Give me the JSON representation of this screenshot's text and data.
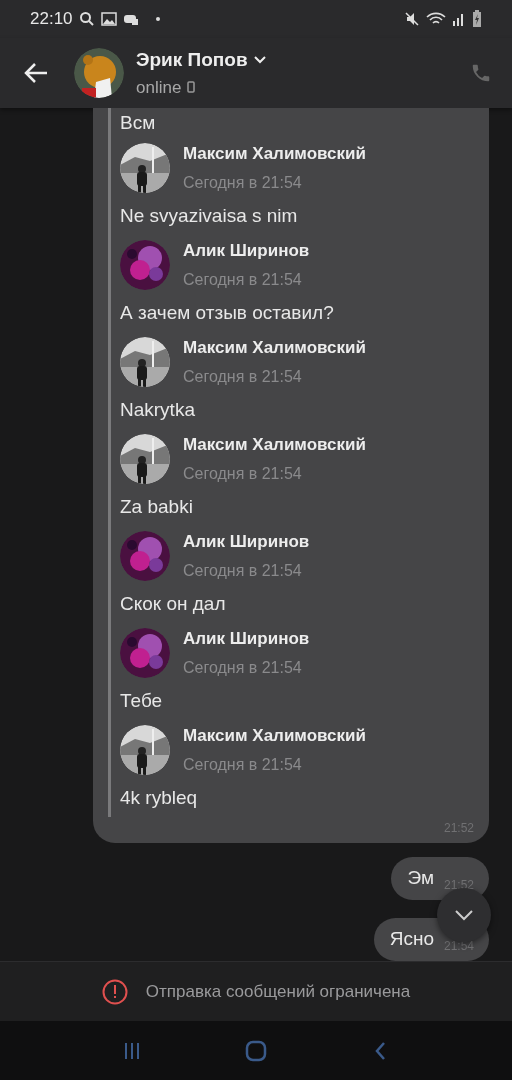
{
  "status_bar": {
    "time": "22:10"
  },
  "header": {
    "name": "Эрик Попов",
    "status": "online"
  },
  "forwarded_message": {
    "top_text": "Всм",
    "time": "21:52",
    "items": [
      {
        "name": "Максим Халимовский",
        "time": "Сегодня в 21:54",
        "text": "Ne svyazivaisa s nim"
      },
      {
        "name": "Алик Ширинов",
        "time": "Сегодня в 21:54",
        "text": "А зачем отзыв оставил?"
      },
      {
        "name": "Максим Халимовский",
        "time": "Сегодня в 21:54",
        "text": "Nakrytka"
      },
      {
        "name": "Максим Халимовский",
        "time": "Сегодня в 21:54",
        "text": "Za babki"
      },
      {
        "name": "Алик Ширинов",
        "time": "Сегодня в 21:54",
        "text": "Скок он дал"
      },
      {
        "name": "Алик Ширинов",
        "time": "Сегодня в 21:54",
        "text": "Тебе"
      },
      {
        "name": "Максим Халимовский",
        "time": "Сегодня в 21:54",
        "text": "4k rybleq"
      }
    ]
  },
  "outgoing": [
    {
      "text": "Эм",
      "time": "21:52"
    },
    {
      "text": "Ясно",
      "time": "21:54"
    }
  ],
  "footer": {
    "notice": "Отправка сообщений ограничена"
  }
}
